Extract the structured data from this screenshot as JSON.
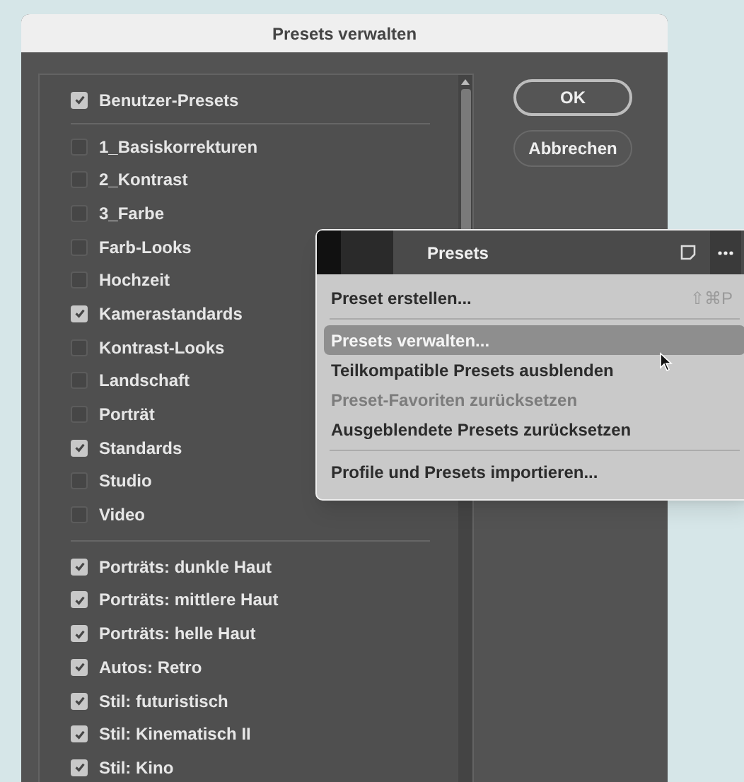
{
  "dialog": {
    "title": "Presets verwalten",
    "groups": [
      {
        "header": {
          "label": "Benutzer-Presets",
          "checked": true
        },
        "items": [
          {
            "label": "1_Basiskorrekturen",
            "checked": false
          },
          {
            "label": "2_Kontrast",
            "checked": false
          },
          {
            "label": "3_Farbe",
            "checked": false
          },
          {
            "label": "Farb-Looks",
            "checked": false
          },
          {
            "label": "Hochzeit",
            "checked": false
          },
          {
            "label": "Kamerastandards",
            "checked": true
          },
          {
            "label": "Kontrast-Looks",
            "checked": false
          },
          {
            "label": "Landschaft",
            "checked": false
          },
          {
            "label": "Porträt",
            "checked": false
          },
          {
            "label": "Standards",
            "checked": true
          },
          {
            "label": "Studio",
            "checked": false
          },
          {
            "label": "Video",
            "checked": false
          }
        ]
      },
      {
        "items": [
          {
            "label": "Porträts: dunkle Haut",
            "checked": true
          },
          {
            "label": "Porträts: mittlere Haut",
            "checked": true
          },
          {
            "label": "Porträts: helle Haut",
            "checked": true
          },
          {
            "label": "Autos: Retro",
            "checked": true
          },
          {
            "label": "Stil: futuristisch",
            "checked": true
          },
          {
            "label": "Stil: Kinematisch II",
            "checked": true
          },
          {
            "label": "Stil: Kino",
            "checked": true
          }
        ]
      }
    ],
    "buttons": [
      {
        "label": "OK",
        "kind": "default"
      },
      {
        "label": "Abbrechen",
        "kind": "normal"
      }
    ]
  },
  "presets_menu": {
    "title": "Presets",
    "items": [
      {
        "label": "Preset erstellen...",
        "shortcut": "⇧⌘P",
        "selected": false,
        "disabled": false
      },
      {
        "kind": "separator"
      },
      {
        "label": "Presets verwalten...",
        "selected": true,
        "disabled": false
      },
      {
        "label": "Teilkompatible Presets ausblenden",
        "selected": false,
        "disabled": false
      },
      {
        "label": "Preset-Favoriten zurücksetzen",
        "selected": false,
        "disabled": true
      },
      {
        "label": "Ausgeblendete Presets zurücksetzen",
        "selected": false,
        "disabled": false
      },
      {
        "kind": "separator"
      },
      {
        "label": "Profile und Presets importieren...",
        "selected": false,
        "disabled": false
      }
    ]
  }
}
